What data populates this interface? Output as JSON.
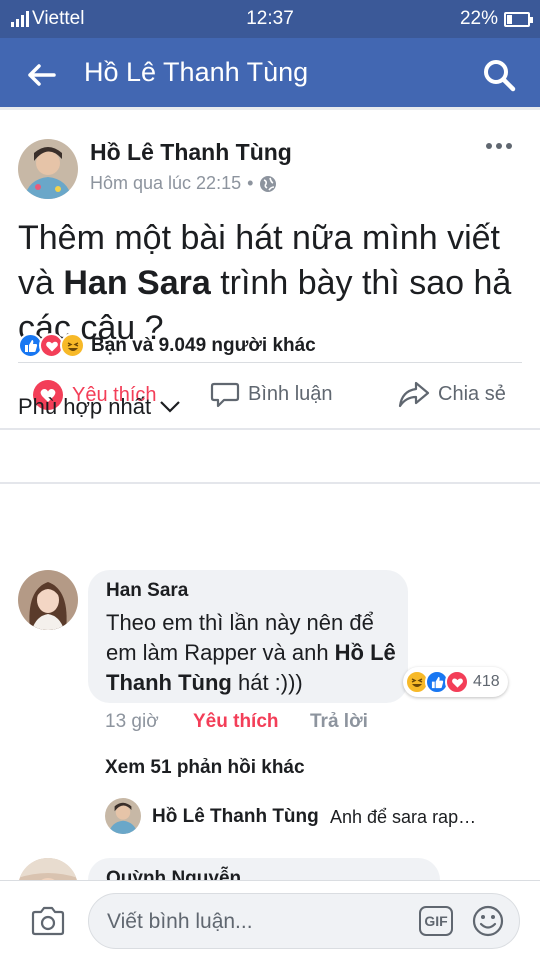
{
  "status_bar": {
    "carrier": "Viettel",
    "time": "12:37",
    "battery": "22%",
    "battery_level": 0.22
  },
  "app_bar": {
    "title": "Hồ Lê Thanh Tùng"
  },
  "post": {
    "author": "Hồ Lê Thanh Tùng",
    "time": "Hôm qua lúc 22:15",
    "text_before": "Thêm một bài hát nữa mình viết và ",
    "text_bold": "Han Sara",
    "text_after": " trình bày thì sao hả các cậu ?"
  },
  "actions": {
    "like": "Yêu thích",
    "comment": "Bình luận",
    "share": "Chia sẻ"
  },
  "reactions": {
    "summary": "Bạn và 9.049 người khác"
  },
  "sort": {
    "label": "Phù hợp nhất"
  },
  "comment1": {
    "name": "Han Sara",
    "text_before": "Theo em thì lần này nên để em làm Rapper và anh ",
    "text_bold": "Hồ Lê Thanh Tùng",
    "text_after": " hát :)))",
    "reaction_count": "418",
    "time": "13 giờ",
    "like": "Yêu thích",
    "reply": "Trả lời"
  },
  "replies": {
    "more_link": "Xem 51 phản hồi khác",
    "reply_name": "Hồ Lê Thanh Tùng",
    "reply_text": "Anh để sara rap…"
  },
  "comment2": {
    "name": "Quỳnh Nguyễn"
  },
  "composer": {
    "placeholder": "Viết bình luận...",
    "gif": "GIF"
  },
  "colors": {
    "header": "#4267b2",
    "status_bar": "#3b5998",
    "like_red": "#f33e58",
    "like_blue": "#1877f2",
    "haha_yellow": "#f7b928"
  }
}
